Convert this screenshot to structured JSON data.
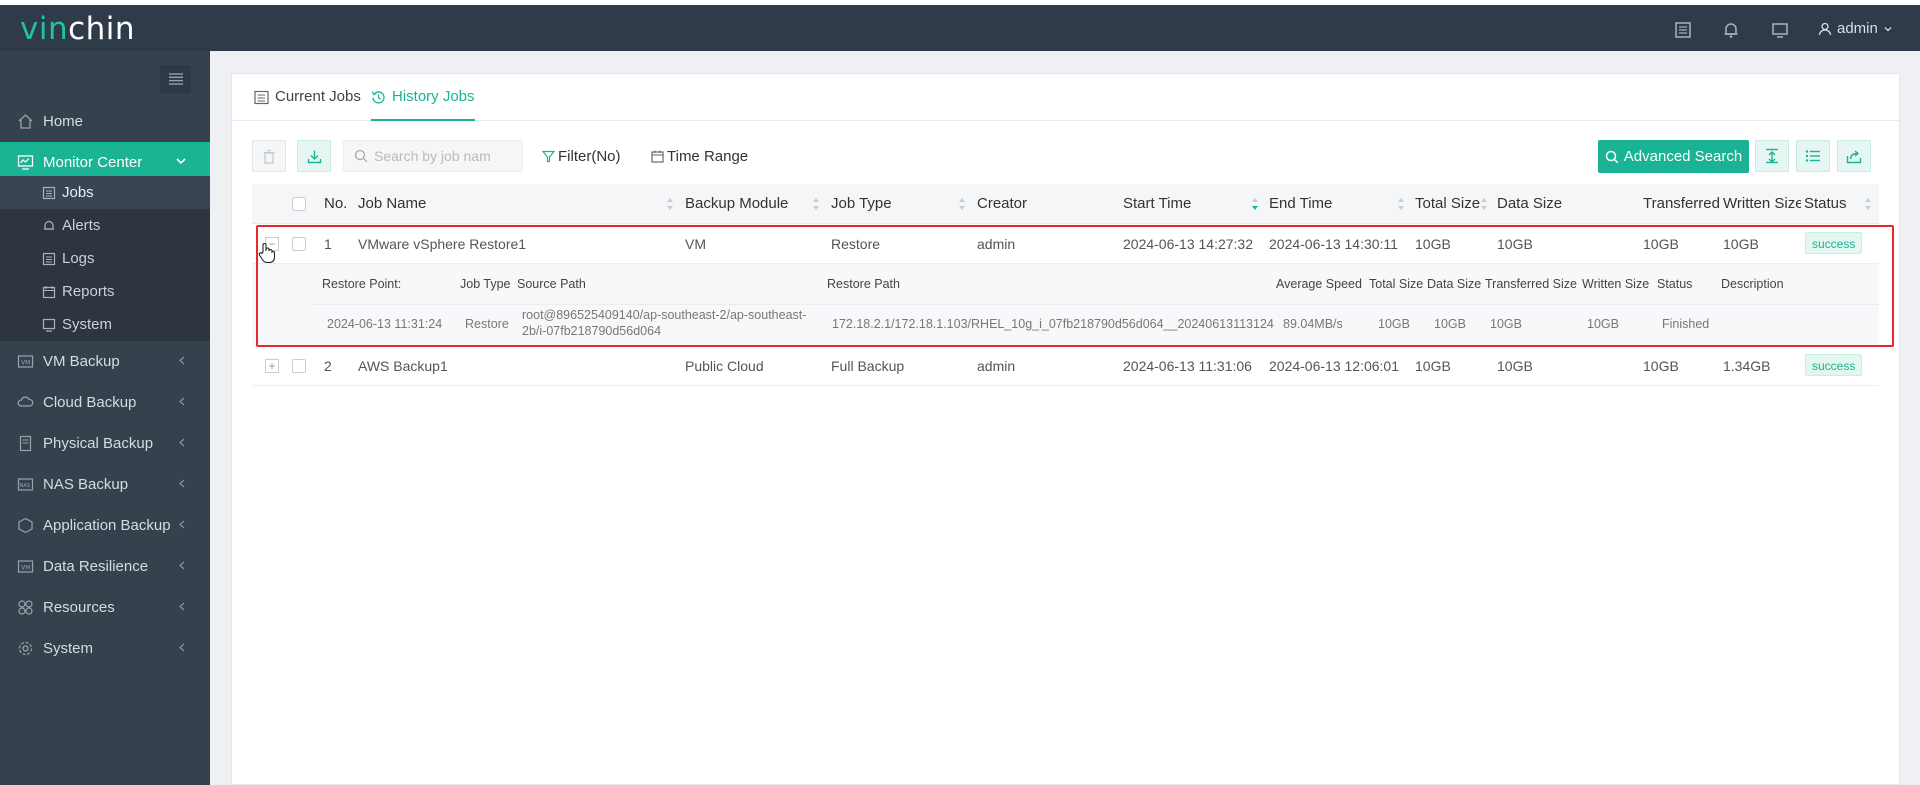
{
  "header": {
    "logo_part1": "vin",
    "logo_part2": "chin",
    "user": "admin",
    "icons": [
      "list-icon",
      "bell-icon",
      "monitor-icon",
      "user-icon"
    ]
  },
  "sidebar": {
    "items": [
      {
        "label": "Home",
        "icon": "home-icon"
      },
      {
        "label": "Monitor Center",
        "icon": "monitor-center-icon",
        "active": true
      },
      {
        "label": "VM Backup",
        "icon": "vm-icon"
      },
      {
        "label": "Cloud Backup",
        "icon": "cloud-icon"
      },
      {
        "label": "Physical Backup",
        "icon": "server-icon"
      },
      {
        "label": "NAS Backup",
        "icon": "nas-icon"
      },
      {
        "label": "Application Backup",
        "icon": "app-icon"
      },
      {
        "label": "Data Resilience",
        "icon": "vm-box-icon"
      },
      {
        "label": "Resources",
        "icon": "resources-icon"
      },
      {
        "label": "System",
        "icon": "gear-icon"
      }
    ],
    "subitems": [
      {
        "label": "Jobs",
        "active": true
      },
      {
        "label": "Alerts"
      },
      {
        "label": "Logs"
      },
      {
        "label": "Reports"
      },
      {
        "label": "System"
      }
    ]
  },
  "tabs": [
    {
      "label": "Current Jobs"
    },
    {
      "label": "History Jobs",
      "active": true
    }
  ],
  "toolbar": {
    "search_placeholder": "Search by job nam",
    "filter_label": "Filter(No)",
    "time_range_label": "Time Range",
    "advanced_search_label": "Advanced Search"
  },
  "table": {
    "headers": [
      "No.",
      "Job Name",
      "Backup Module",
      "Job Type",
      "Creator",
      "Start Time",
      "End Time",
      "Total Size",
      "Data Size",
      "Transferred",
      "Written Size",
      "Status"
    ],
    "rows": [
      {
        "no": "1",
        "job_name": "VMware vSphere Restore1",
        "module": "VM",
        "job_type": "Restore",
        "creator": "admin",
        "start": "2024-06-13 14:27:32",
        "end": "2024-06-13 14:30:11",
        "total": "10GB",
        "data": "10GB",
        "transferred": "10GB",
        "written": "10GB",
        "status": "success"
      },
      {
        "no": "2",
        "job_name": "AWS Backup1",
        "module": "Public Cloud",
        "job_type": "Full Backup",
        "creator": "admin",
        "start": "2024-06-13 11:31:06",
        "end": "2024-06-13 12:06:01",
        "total": "10GB",
        "data": "10GB",
        "transferred": "10GB",
        "written": "1.34GB",
        "status": "success"
      }
    ],
    "detail": {
      "headers": [
        "Restore Point:",
        "Job Type",
        "Source Path",
        "Restore Path",
        "Average Speed",
        "Total Size",
        "Data Size",
        "Transferred Size",
        "Written Size",
        "Status",
        "Description"
      ],
      "values": {
        "restore_point": "2024-06-13 11:31:24",
        "job_type": "Restore",
        "source_path_line1": "root@896525409140/ap-southeast-2/ap-southeast-",
        "source_path_line2": "2b/i-07fb218790d56d064",
        "restore_path": "172.18.2.1/172.18.1.103/RHEL_10g_i_07fb218790d56d064__20240613113124",
        "avg_speed": "89.04MB/s",
        "total": "10GB",
        "data": "10GB",
        "transferred": "10GB",
        "written": "10GB",
        "status": "Finished"
      }
    }
  },
  "colors": {
    "accent": "#1ab394",
    "header_bg": "#2f3b48",
    "sidebar_bg": "#36414e",
    "highlight": "#e8282e"
  }
}
